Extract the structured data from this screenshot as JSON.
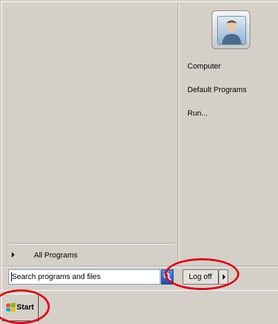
{
  "start_menu": {
    "left_pane": {
      "all_programs_label": "All Programs",
      "search_placeholder": "Search programs and files"
    },
    "right_pane": {
      "user_picture": "user-avatar",
      "links": [
        {
          "label": "Computer"
        },
        {
          "label": "Default Programs"
        },
        {
          "label": "Run..."
        }
      ]
    },
    "shutdown": {
      "log_off_label": "Log off"
    }
  },
  "taskbar": {
    "start_label": "Start"
  },
  "annotations": {
    "color": "#e00010"
  }
}
